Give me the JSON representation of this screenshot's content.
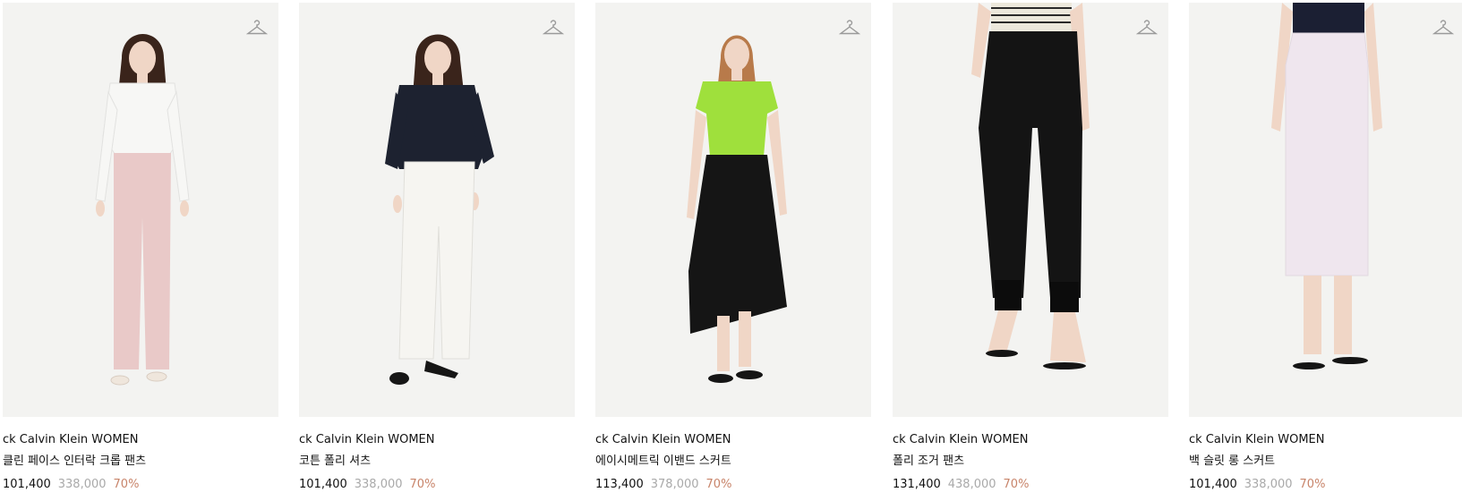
{
  "colors": {
    "photo_bg": "#f3f3f1",
    "price": "#111111",
    "original_price": "#a9a9a9",
    "discount": "#c8846a",
    "hanger_icon": "#9a9a9a"
  },
  "products": [
    {
      "brand": "ck Calvin Klein WOMEN",
      "name": "클린 페이스 인터락 크롭 팬츠",
      "price": "101,400",
      "original_price": "338,000",
      "discount": "70%",
      "icon": "hanger-icon",
      "top_color": "#f7f7f5",
      "bottom_color": "#e9c9c8",
      "shoe_color": "#efe6dc"
    },
    {
      "brand": "ck Calvin Klein WOMEN",
      "name": "코튼 폴리 셔츠",
      "price": "101,400",
      "original_price": "338,000",
      "discount": "70%",
      "icon": "hanger-icon",
      "top_color": "#1d2230",
      "bottom_color": "#f6f5f1",
      "shoe_color": "#161616"
    },
    {
      "brand": "ck Calvin Klein WOMEN",
      "name": "에이시메트릭 이밴드 스커트",
      "price": "113,400",
      "original_price": "378,000",
      "discount": "70%",
      "icon": "hanger-icon",
      "top_color": "#9fe03c",
      "bottom_color": "#151515",
      "shoe_color": "#151515"
    },
    {
      "brand": "ck Calvin Klein WOMEN",
      "name": "폴리 조거 팬츠",
      "price": "131,400",
      "original_price": "438,000",
      "discount": "70%",
      "icon": "hanger-icon",
      "top_color": "#ece8dc",
      "bottom_color": "#141414",
      "shoe_color": "#141414"
    },
    {
      "brand": "ck Calvin Klein WOMEN",
      "name": "백 슬릿 롱 스커트",
      "price": "101,400",
      "original_price": "338,000",
      "discount": "70%",
      "icon": "hanger-icon",
      "top_color": "#1b1f33",
      "bottom_color": "#efe6ee",
      "shoe_color": "#141414"
    }
  ]
}
